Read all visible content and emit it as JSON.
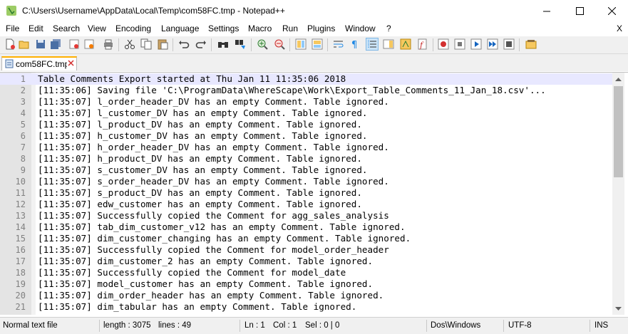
{
  "window": {
    "title": "C:\\Users\\Username\\AppData\\Local\\Temp\\com58FC.tmp - Notepad++",
    "minimize_icon": "minimize-icon",
    "maximize_icon": "maximize-icon",
    "close_icon": "close-icon"
  },
  "menu": {
    "items": [
      "File",
      "Edit",
      "Search",
      "View",
      "Encoding",
      "Language",
      "Settings",
      "Macro",
      "Run",
      "Plugins",
      "Window",
      "?"
    ],
    "close_label": "X"
  },
  "toolbar": {
    "icons": [
      "new-file-icon",
      "open-file-icon",
      "save-icon",
      "save-all-icon",
      "close-icon",
      "close-all-icon",
      "print-icon",
      "cut-icon",
      "copy-icon",
      "paste-icon",
      "undo-icon",
      "redo-icon",
      "find-icon",
      "replace-icon",
      "zoom-in-icon",
      "zoom-out-icon",
      "sync-vertical-icon",
      "sync-horizontal-icon",
      "word-wrap-icon",
      "show-all-chars-icon",
      "indent-guide-icon",
      "doc-map-icon",
      "function-list-icon",
      "folder-workspace-icon",
      "record-macro-icon",
      "stop-recording-icon",
      "play-macro-icon",
      "run-macro-multiple-icon",
      "save-macro-icon",
      "launch-in-browser-icon"
    ]
  },
  "tab": {
    "label": "com58FC.tmp",
    "icon": "file-tab-icon",
    "close_icon": "tab-close-icon"
  },
  "editor": {
    "current_line": 1,
    "lines": [
      {
        "n": "1",
        "text": "Table Comments Export started at Thu Jan 11 11:35:06 2018"
      },
      {
        "n": "2",
        "text": "[11:35:06] Saving file 'C:\\ProgramData\\WhereScape\\Work\\Export_Table_Comments_11_Jan_18.csv'..."
      },
      {
        "n": "3",
        "text": "[11:35:07] l_order_header_DV has an empty Comment. Table ignored."
      },
      {
        "n": "4",
        "text": "[11:35:07] l_customer_DV has an empty Comment. Table ignored."
      },
      {
        "n": "5",
        "text": "[11:35:07] l_product_DV has an empty Comment. Table ignored."
      },
      {
        "n": "6",
        "text": "[11:35:07] h_customer_DV has an empty Comment. Table ignored."
      },
      {
        "n": "7",
        "text": "[11:35:07] h_order_header_DV has an empty Comment. Table ignored."
      },
      {
        "n": "8",
        "text": "[11:35:07] h_product_DV has an empty Comment. Table ignored."
      },
      {
        "n": "9",
        "text": "[11:35:07] s_customer_DV has an empty Comment. Table ignored."
      },
      {
        "n": "10",
        "text": "[11:35:07] s_order_header_DV has an empty Comment. Table ignored."
      },
      {
        "n": "11",
        "text": "[11:35:07] s_product_DV has an empty Comment. Table ignored."
      },
      {
        "n": "12",
        "text": "[11:35:07] edw_customer has an empty Comment. Table ignored."
      },
      {
        "n": "13",
        "text": "[11:35:07] Successfully copied the Comment for agg_sales_analysis"
      },
      {
        "n": "14",
        "text": "[11:35:07] tab_dim_customer_v12 has an empty Comment. Table ignored."
      },
      {
        "n": "15",
        "text": "[11:35:07] dim_customer_changing has an empty Comment. Table ignored."
      },
      {
        "n": "16",
        "text": "[11:35:07] Successfully copied the Comment for model_order_header"
      },
      {
        "n": "17",
        "text": "[11:35:07] dim_customer_2 has an empty Comment. Table ignored."
      },
      {
        "n": "18",
        "text": "[11:35:07] Successfully copied the Comment for model_date"
      },
      {
        "n": "19",
        "text": "[11:35:07] model_customer has an empty Comment. Table ignored."
      },
      {
        "n": "20",
        "text": "[11:35:07] dim_order_header has an empty Comment. Table ignored."
      },
      {
        "n": "21",
        "text": "[11:35:07] dim_tabular has an empty Comment. Table ignored."
      }
    ]
  },
  "status": {
    "doc_type": "Normal text file",
    "length": "length : 3075",
    "lines": "lines : 49",
    "ln": "Ln : 1",
    "col": "Col : 1",
    "sel": "Sel : 0 | 0",
    "eol": "Dos\\Windows",
    "encoding": "UTF-8",
    "ins": "INS"
  },
  "colors": {
    "current_line": "#e8e8ff",
    "gutter": "#e4e4e4",
    "active_tab_accent": "#ffb000"
  }
}
